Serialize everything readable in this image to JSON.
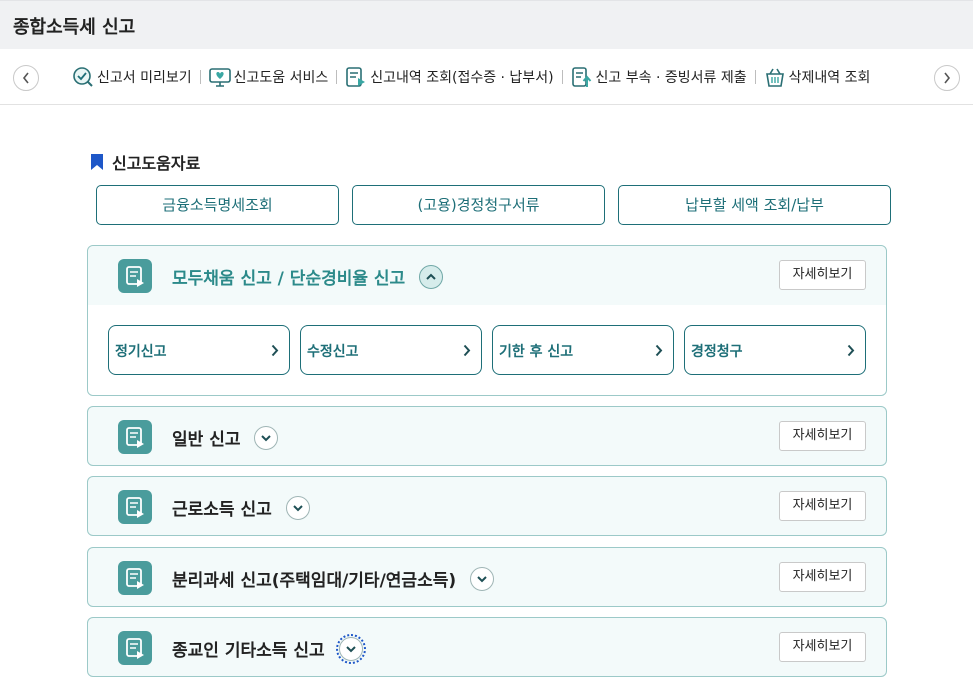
{
  "page": {
    "title": "종합소득세 신고"
  },
  "quickbar": {
    "items": [
      {
        "label": "신고서 미리보기",
        "icon": "magnifier-check-icon"
      },
      {
        "label": "신고도움 서비스",
        "icon": "monitor-heart-icon"
      },
      {
        "label": "신고내역 조회(접수증 · 납부서)",
        "icon": "document-play-icon"
      },
      {
        "label": "신고 부속 · 증빙서류 제출",
        "icon": "document-upload-icon"
      },
      {
        "label": "삭제내역 조회",
        "icon": "trash-basket-icon"
      }
    ]
  },
  "help": {
    "heading": "신고도움자료",
    "buttons": [
      "금융소득명세조회",
      "(고용)경정청구서류",
      "납부할 세액 조회/납부"
    ]
  },
  "panels": [
    {
      "title": "모두채움 신고 / 단순경비율 신고",
      "detail": "자세히보기",
      "expanded": true,
      "sub": [
        "정기신고",
        "수정신고",
        "기한 후 신고",
        "경정청구"
      ]
    },
    {
      "title": "일반 신고",
      "detail": "자세히보기",
      "expanded": false
    },
    {
      "title": "근로소득 신고",
      "detail": "자세히보기",
      "expanded": false
    },
    {
      "title": "분리과세 신고(주택임대/기타/연금소득)",
      "detail": "자세히보기",
      "expanded": false
    },
    {
      "title": "종교인 기타소득 신고",
      "detail": "자세히보기",
      "expanded": false
    }
  ],
  "colors": {
    "accent": "#1e6f78",
    "panel_bg": "#f3fafa",
    "panel_border": "#9cc9c8",
    "icon_tile": "#4a9c9c",
    "bookmark": "#1e57c8"
  }
}
